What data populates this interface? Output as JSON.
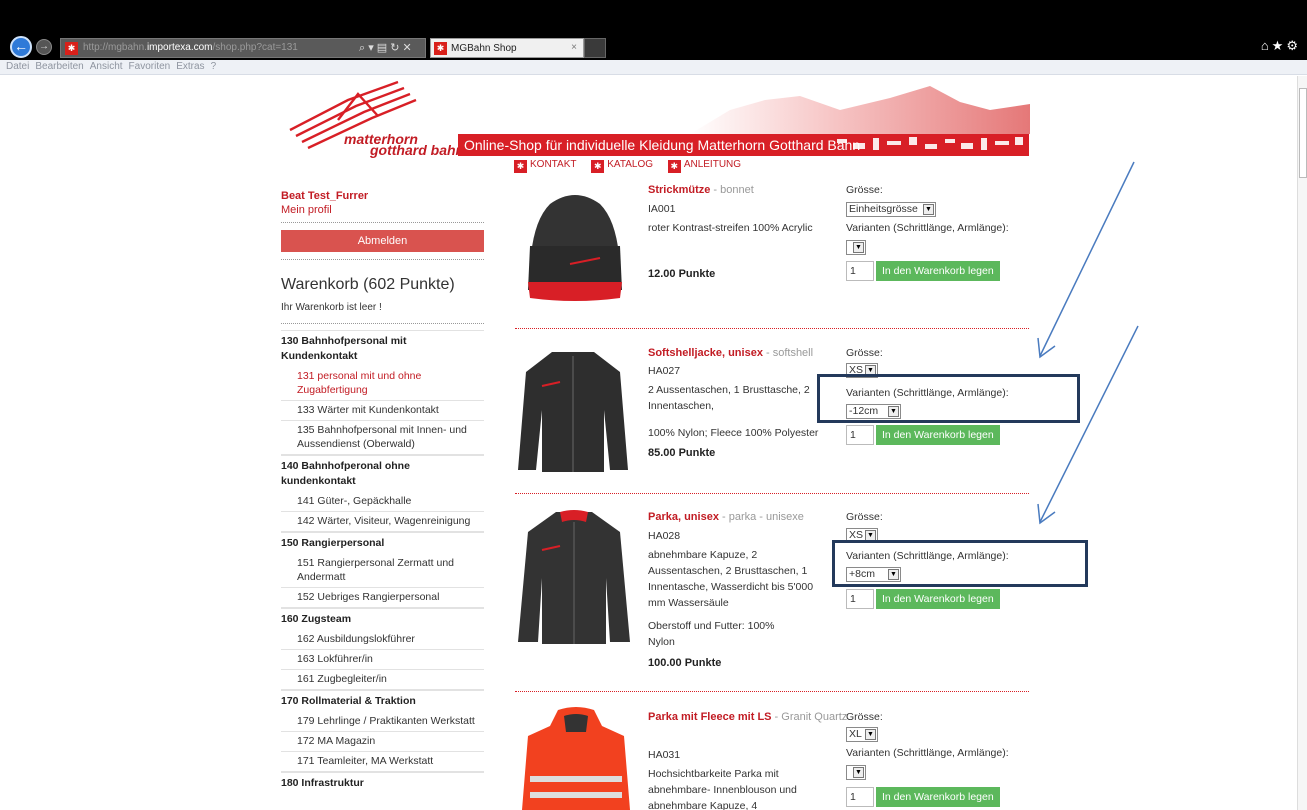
{
  "browser": {
    "url_gray_prefix": "http://mgbahn.",
    "url_domain": "importexa.com",
    "url_path": "/shop.php?cat=131",
    "url_controls": "⌕ ▾ ▤ ↻ ✕",
    "tab_title": "MGBahn Shop",
    "tab_close": "×",
    "right_icons": "⌂★⚙",
    "menu": [
      "Datei",
      "Bearbeiten",
      "Ansicht",
      "Favoriten",
      "Extras",
      "?"
    ]
  },
  "header": {
    "logo_line1": "matterhorn",
    "logo_line2": "gotthard bahn",
    "banner_title": "Online-Shop für individuelle Kleidung Matterhorn Gotthard Bahn",
    "nav": [
      "KONTAKT",
      "KATALOG",
      "ANLEITUNG"
    ]
  },
  "sidebar": {
    "user_name": "Beat Test_Furrer",
    "profile_link": "Mein profil",
    "logout": "Abmelden",
    "cart_title": "Warenkorb (602 Punkte)",
    "cart_status": "Ihr Warenkorb ist leer !",
    "categories": [
      {
        "title": "130 Bahnhofpersonal mit Kundenkontakt",
        "items": [
          {
            "label": "131 personal mit und ohne Zugabfertigung",
            "active": true
          },
          {
            "label": "133 Wärter mit Kundenkontakt",
            "active": false
          },
          {
            "label": "135 Bahnhofpersonal mit Innen- und Aussendienst (Oberwald)",
            "active": false
          }
        ]
      },
      {
        "title": "140 Bahnhofperonal ohne kundenkontakt",
        "items": [
          {
            "label": "141 Güter-, Gepäckhalle",
            "active": false
          },
          {
            "label": "142 Wärter, Visiteur, Wagenreinigung",
            "active": false
          }
        ]
      },
      {
        "title": "150 Rangierpersonal",
        "items": [
          {
            "label": "151 Rangierpersonal Zermatt und Andermatt",
            "active": false
          },
          {
            "label": "152 Uebriges Rangierpersonal",
            "active": false
          }
        ]
      },
      {
        "title": "160 Zugsteam",
        "items": [
          {
            "label": "162 Ausbildungslokführer",
            "active": false
          },
          {
            "label": "163 Lokführer/in",
            "active": false
          },
          {
            "label": "161 Zugbegleiter/in",
            "active": false
          }
        ]
      },
      {
        "title": "170 Rollmaterial & Traktion",
        "items": [
          {
            "label": "179 Lehrlinge / Praktikanten Werkstatt",
            "active": false
          },
          {
            "label": "172 MA Magazin",
            "active": false
          },
          {
            "label": "171 Teamleiter, MA Werkstatt",
            "active": false
          }
        ]
      },
      {
        "title": "180 Infrastruktur",
        "items": []
      }
    ]
  },
  "labels": {
    "size": "Grösse:",
    "variants": "Varianten (Schrittlänge, Armlänge):",
    "add_to_cart": "In den Warenkorb legen"
  },
  "products": [
    {
      "name": "Strickmütze",
      "sub": " - bonnet",
      "code": "IA001",
      "desc": "roter Kontrast-streifen 100% Acrylic",
      "desc2": "",
      "points": "12.00 Punkte",
      "size": "Einheitsgrösse",
      "variant": "",
      "qty": "1"
    },
    {
      "name": "Softshelljacke, unisex",
      "sub": " - softshell",
      "code": "HA027",
      "desc": "2 Aussentaschen, 1 Brusttasche, 2 Innentaschen,",
      "desc2": "100% Nylon; Fleece 100% Polyester",
      "points": "85.00 Punkte",
      "size": "XS",
      "variant": "-12cm",
      "qty": "1"
    },
    {
      "name": "Parka, unisex",
      "sub": " - parka - unisexe",
      "code": "HA028",
      "desc": "abnehmbare Kapuze, 2 Aussentaschen, 2 Brusttaschen, 1 Innentasche, Wasserdicht bis 5'000 mm Wassersäule",
      "desc2": "Oberstoff und Futter: 100% Nylon",
      "points": "100.00 Punkte",
      "size": "XS",
      "variant": "+8cm",
      "qty": "1"
    },
    {
      "name": "Parka mit Fleece mit LS",
      "sub": " - Granit Quartz",
      "code": "HA031",
      "desc": "Hochsichtbarkeite Parka mit abnehmbare- Innenblouson und abnehmbare Kapuze, 4",
      "desc2": "",
      "points": "",
      "size": "XL",
      "variant": "",
      "qty": "1"
    }
  ],
  "colors": {
    "brand_red": "#d81f26",
    "button_green": "#5cb85c",
    "highlight": "#23395b",
    "arrow": "#4a7bbf"
  }
}
